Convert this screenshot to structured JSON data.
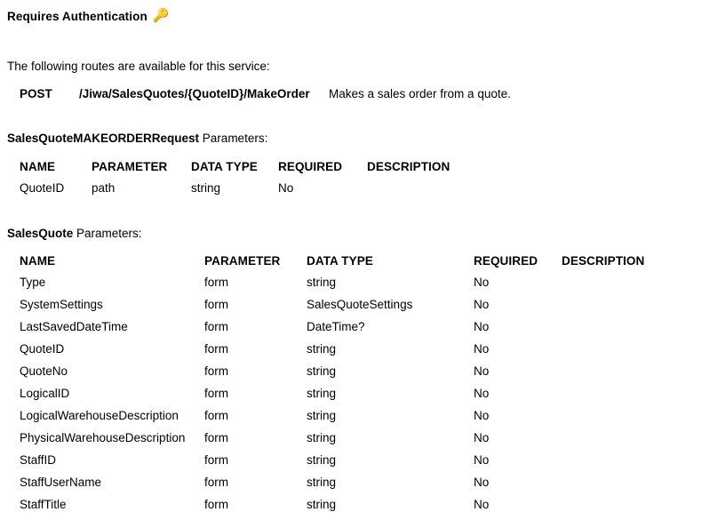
{
  "auth": {
    "heading": "Requires Authentication",
    "icon": "key-icon",
    "icon_glyph": "🔑",
    "icon_color": "#FFD700"
  },
  "intro": {
    "text": "The following routes are available for this service:"
  },
  "routes": [
    {
      "verb": "POST",
      "path": "/Jiwa/SalesQuotes/{QuoteID}/MakeOrder",
      "description": "Makes a sales order from a quote."
    }
  ],
  "sections": [
    {
      "id": "request",
      "strong": "SalesQuoteMAKEORDERRequest",
      "suffix": " Parameters:"
    },
    {
      "id": "entity",
      "strong": "SalesQuote",
      "suffix": " Parameters:"
    }
  ],
  "tables": {
    "request": {
      "columns": [
        "NAME",
        "PARAMETER",
        "DATA TYPE",
        "REQUIRED",
        "DESCRIPTION"
      ],
      "rows": [
        [
          "QuoteID",
          "path",
          "string",
          "No",
          ""
        ]
      ]
    },
    "entity": {
      "columns": [
        "NAME",
        "PARAMETER",
        "DATA TYPE",
        "REQUIRED",
        "DESCRIPTION"
      ],
      "rows": [
        [
          "Type",
          "form",
          "string",
          "No",
          ""
        ],
        [
          "SystemSettings",
          "form",
          "SalesQuoteSettings",
          "No",
          ""
        ],
        [
          "LastSavedDateTime",
          "form",
          "DateTime?",
          "No",
          ""
        ],
        [
          "QuoteID",
          "form",
          "string",
          "No",
          ""
        ],
        [
          "QuoteNo",
          "form",
          "string",
          "No",
          ""
        ],
        [
          "LogicalID",
          "form",
          "string",
          "No",
          ""
        ],
        [
          "LogicalWarehouseDescription",
          "form",
          "string",
          "No",
          ""
        ],
        [
          "PhysicalWarehouseDescription",
          "form",
          "string",
          "No",
          ""
        ],
        [
          "StaffID",
          "form",
          "string",
          "No",
          ""
        ],
        [
          "StaffUserName",
          "form",
          "string",
          "No",
          ""
        ],
        [
          "StaffTitle",
          "form",
          "string",
          "No",
          ""
        ]
      ]
    }
  }
}
